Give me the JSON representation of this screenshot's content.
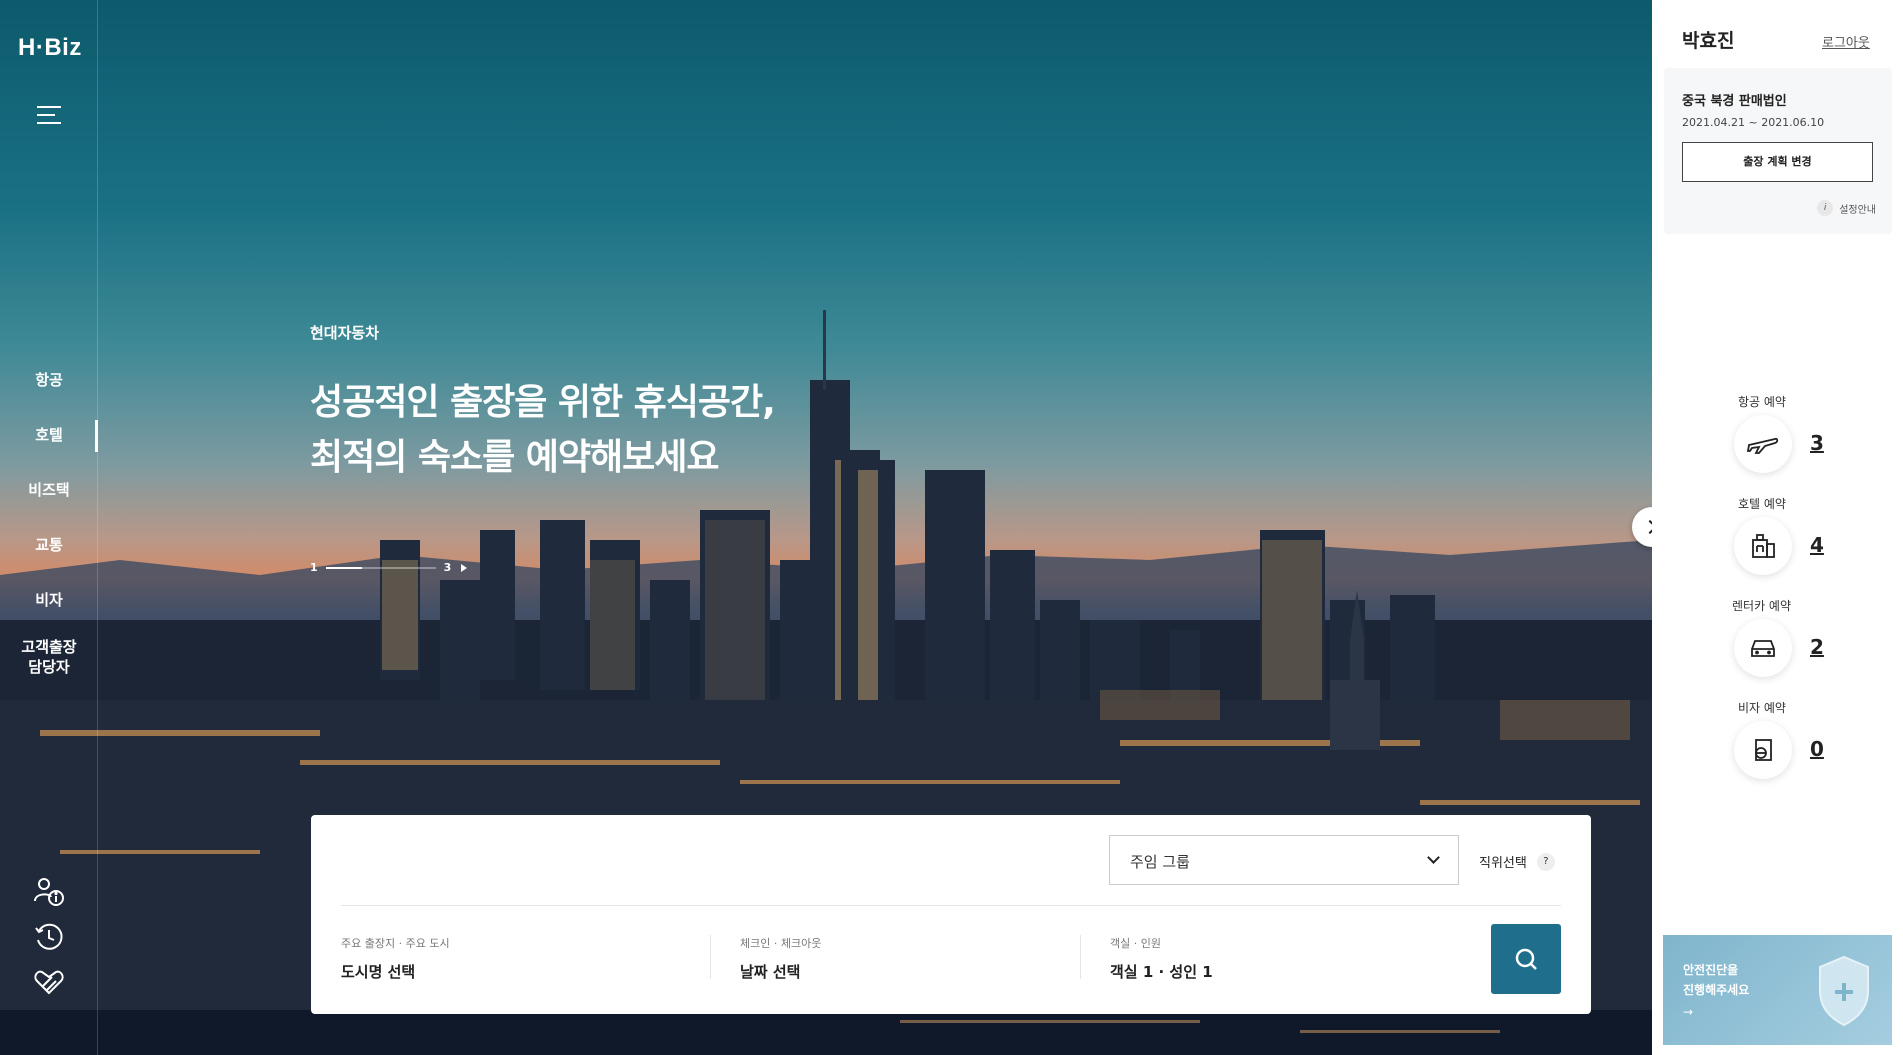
{
  "app": {
    "logo": "H·Biz"
  },
  "leftnav": {
    "items": [
      {
        "label": "항공",
        "active": false
      },
      {
        "label": "호텔",
        "active": true
      },
      {
        "label": "비즈택",
        "active": false
      },
      {
        "label": "교통",
        "active": false
      },
      {
        "label": "비자",
        "active": false
      },
      {
        "label": "고객출장\n담당자",
        "active": false
      }
    ],
    "bottom_icons": [
      "user-info-icon",
      "history-clock-icon",
      "heart-hands-icon"
    ]
  },
  "hero": {
    "brand": "현대자동차",
    "headline_line1": "성공적인 출장을 위한 휴식공간,",
    "headline_line2": "최적의 숙소를 예약해보세요",
    "pager_current": "1",
    "pager_total": "3"
  },
  "search": {
    "group_select": "주임 그룹",
    "position_label": "직위선택",
    "position_help": "?",
    "fields": [
      {
        "label": "주요 출장지 · 주요 도시",
        "value": "도시명 선택"
      },
      {
        "label": "체크인 · 체크아웃",
        "value": "날짜 선택"
      },
      {
        "label": "객실 · 인원",
        "value": "객실 1 · 성인 1"
      }
    ]
  },
  "user": {
    "name": "박효진",
    "logout": "로그아웃",
    "trip": {
      "company": "중국 북경 판매법인",
      "dates": "2021.04.21 ~ 2021.06.10",
      "change_button": "출장 계획 변경",
      "guide_icon": "i",
      "guide": "설정안내"
    }
  },
  "bookings": [
    {
      "label": "항공 예약",
      "icon": "airplane-icon",
      "count": "3"
    },
    {
      "label": "호텔 예약",
      "icon": "hotel-icon",
      "count": "4"
    },
    {
      "label": "렌터카 예약",
      "icon": "car-icon",
      "count": "2"
    },
    {
      "label": "비자 예약",
      "icon": "passport-icon",
      "count": "0"
    }
  ],
  "safety": {
    "line1": "안전진단을",
    "line2": "진행해주세요",
    "arrow": "→"
  },
  "colors": {
    "accent": "#1f6e8c",
    "panel_bg": "#f6f7f8",
    "safety_bg": "#a5cde0"
  }
}
